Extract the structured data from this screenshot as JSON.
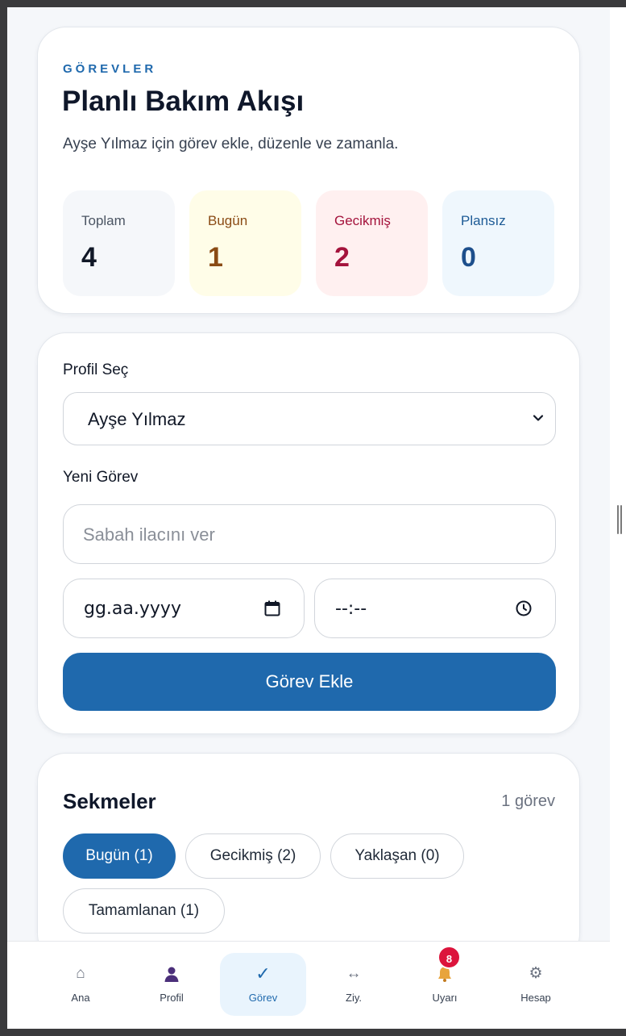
{
  "header": {
    "eyebrow": "GÖREVLER",
    "title": "Planlı Bakım Akışı",
    "subtitle": "Ayşe Yılmaz için görev ekle, düzenle ve zamanla."
  },
  "stats": [
    {
      "label": "Toplam",
      "value": "4"
    },
    {
      "label": "Bugün",
      "value": "1"
    },
    {
      "label": "Gecikmiş",
      "value": "2"
    },
    {
      "label": "Plansız",
      "value": "0"
    }
  ],
  "form": {
    "profile_label": "Profil Seç",
    "profile_value": "Ayşe Yılmaz",
    "new_task_label": "Yeni Görev",
    "task_placeholder": "Sabah ilacını ver",
    "date_placeholder": "gg.aa.yyyy",
    "time_placeholder": "--:--",
    "submit_label": "Görev Ekle"
  },
  "tabs": {
    "title": "Sekmeler",
    "count": "1 görev",
    "items": [
      {
        "label": "Bugün (1)",
        "active": true
      },
      {
        "label": "Gecikmiş (2)",
        "active": false
      },
      {
        "label": "Yaklaşan (0)",
        "active": false
      },
      {
        "label": "Tamamlanan (1)",
        "active": false
      }
    ]
  },
  "nav": {
    "items": [
      {
        "label": "Ana",
        "icon": "home-icon"
      },
      {
        "label": "Profil",
        "icon": "person-icon"
      },
      {
        "label": "Görev",
        "icon": "check-icon"
      },
      {
        "label": "Ziy.",
        "icon": "arrows-icon"
      },
      {
        "label": "Uyarı",
        "icon": "bell-icon"
      },
      {
        "label": "Hesap",
        "icon": "gear-icon"
      }
    ],
    "active": "Görev",
    "alert_badge": "8"
  },
  "colors": {
    "primary": "#1f69ad",
    "today_bg": "#fffde8",
    "overdue_bg": "#fff0f0",
    "unplanned_bg": "#eff7fd",
    "badge": "#dc143c"
  }
}
